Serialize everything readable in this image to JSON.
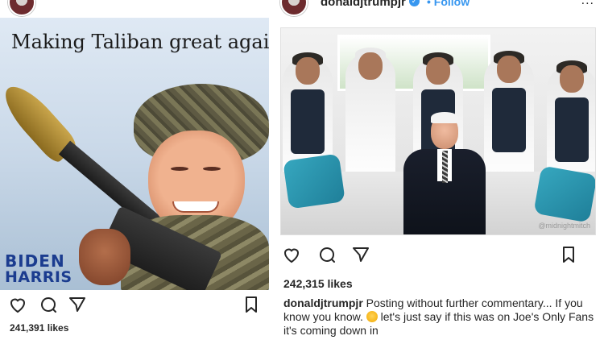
{
  "left_post": {
    "headline": "Making Taliban great again!",
    "brand_line1": "BIDEN",
    "brand_line2": "HARRIS",
    "likes": "241,391 likes"
  },
  "right_post": {
    "username": "donaldjtrumpjr",
    "follow_label": "• Follow",
    "more_label": "...",
    "watermark": "@midnightmitch",
    "likes": "242,315 likes",
    "caption": {
      "user": "donaldjtrumpjr",
      "text_part1": " Posting without further commentary... If you know you know. ",
      "emoji": "😏",
      "text_part2": " let's just say if this was on Joe's Only Fans it's coming down in"
    }
  },
  "icons": {
    "like": "heart-icon",
    "comment": "comment-icon",
    "share": "paper-plane-icon",
    "save": "bookmark-icon"
  },
  "colors": {
    "link_blue": "#3897f0",
    "text": "#262626"
  }
}
